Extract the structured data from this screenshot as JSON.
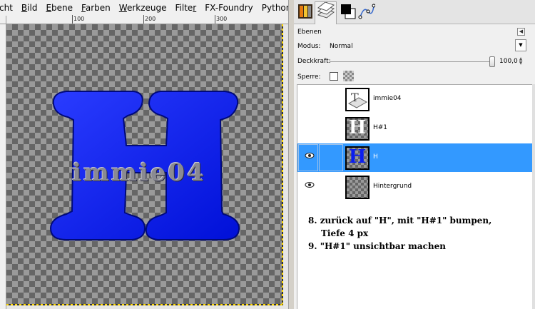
{
  "menubar": {
    "items": [
      "cht",
      "Bild",
      "Ebene",
      "Farben",
      "Werkzeuge",
      "Filter",
      "FX-Foundry",
      "Python-Fu"
    ]
  },
  "ruler": {
    "labels": [
      "100",
      "200",
      "300"
    ]
  },
  "canvas_text": "immie04",
  "layers_panel": {
    "title": "Ebenen",
    "mode_label": "Modus:",
    "mode_value": "Normal",
    "opacity_label": "Deckkraft:",
    "opacity_value": "100,0",
    "lock_label": "Sperre:",
    "layers": [
      {
        "name": "immie04",
        "visible": false,
        "selected": false,
        "thumb": "text"
      },
      {
        "name": "H#1",
        "visible": false,
        "selected": false,
        "thumb": "white-H"
      },
      {
        "name": "H",
        "visible": true,
        "selected": true,
        "thumb": "blue-H"
      },
      {
        "name": "Hintergrund",
        "visible": true,
        "selected": false,
        "thumb": "transparent"
      }
    ]
  },
  "instructions": {
    "line1": "8. zurück auf \"H\", mit \"H#1\" bumpen,",
    "line2": "Tiefe 4 px",
    "line3": "9. \"H#1\" unsichtbar machen"
  },
  "colors": {
    "selection": "#3399ff",
    "letter_blue": "#0a1ef0"
  }
}
